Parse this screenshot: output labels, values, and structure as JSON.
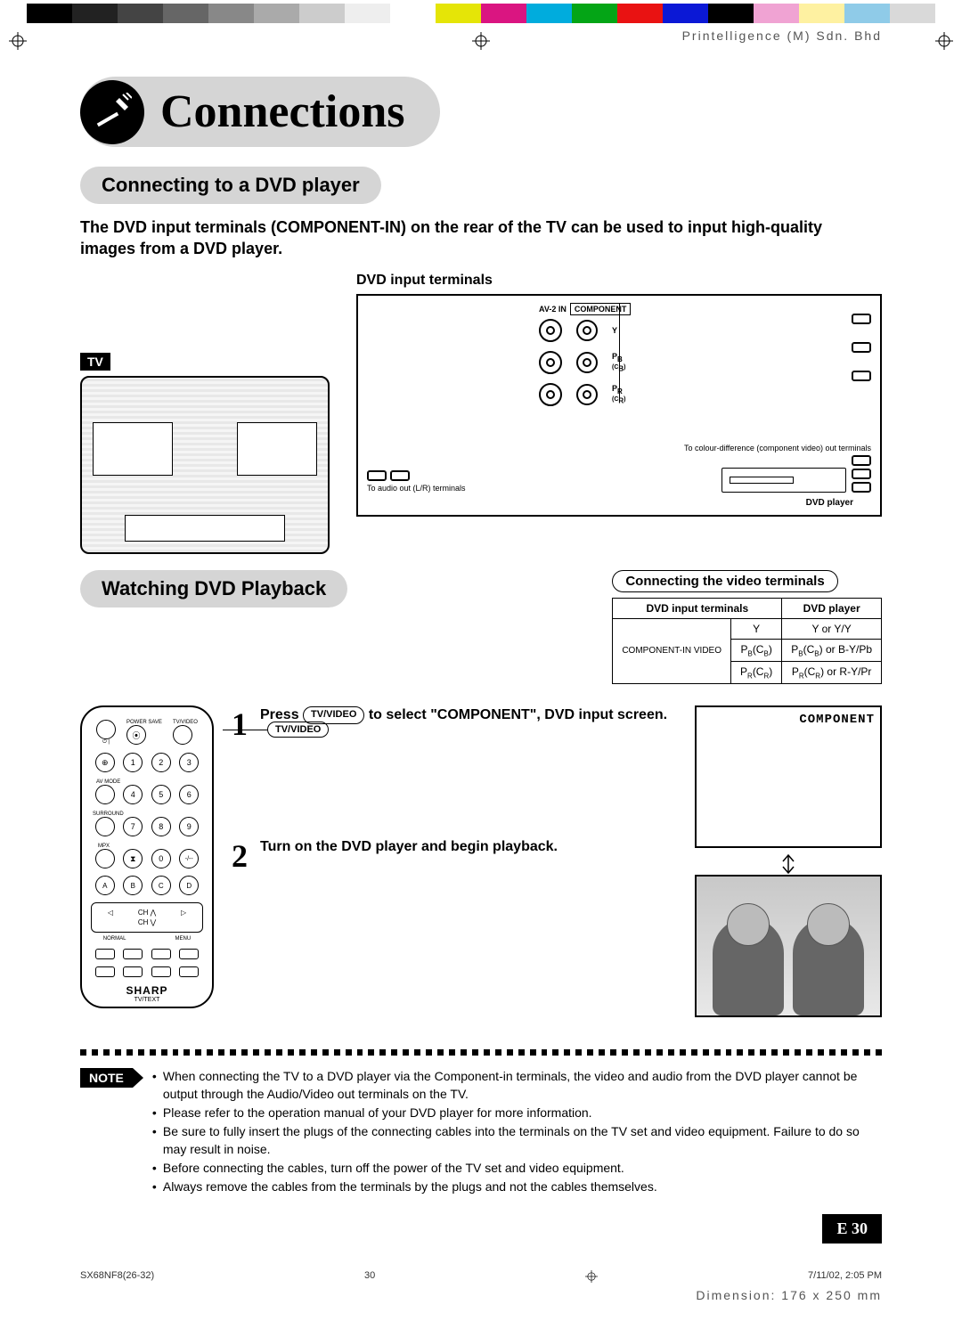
{
  "proof": {
    "printer": "Printelligence (M) Sdn. Bhd",
    "colors": [
      "#000000",
      "#222222",
      "#444444",
      "#666666",
      "#888888",
      "#aaaaaa",
      "#cccccc",
      "#eeeeee",
      "#ffffff",
      "#e5e507",
      "#da1581",
      "#00acdd",
      "#04a516",
      "#e91212",
      "#0b18d6",
      "#000000",
      "#f0a3d3",
      "#fef1a1",
      "#8fcbe8",
      "#d9d9d9"
    ],
    "file": "SX68NF8(26-32)",
    "sheet": "30",
    "timestamp": "7/11/02, 2:05 PM",
    "dimension": "Dimension: 176 x 250 mm"
  },
  "title": "Connections",
  "section1": {
    "heading": "Connecting to a DVD player",
    "lead": "The DVD input terminals (COMPONENT-IN) on the rear of the TV can be used to input high-quality images from a DVD player.",
    "tv_label": "TV",
    "dvd_inputs_label": "DVD input terminals",
    "panel_top_left": "AV-2 IN",
    "panel_top_right": "COMPONENT",
    "jack_y": "Y",
    "jack_pb": "PB (CB)",
    "jack_pr": "PR (CR)",
    "to_audio": "To audio out (L/R) terminals",
    "to_colour": "To colour-difference (component video) out terminals",
    "dvd_player_label": "DVD player",
    "table_caption": "Connecting the video terminals",
    "table": {
      "head1": "DVD input terminals",
      "head2": "DVD player",
      "row_group": "COMPONENT-IN VIDEO",
      "r1c1": "Y",
      "r1c2": "Y or Y/Y",
      "r2c1": "PB(CB)",
      "r2c2": "PB(CB) or B-Y/Pb",
      "r3c1": "PR(CR)",
      "r3c2": "PR(CR) or R-Y/Pr"
    }
  },
  "section2": {
    "heading": "Watching DVD Playback",
    "remote_callout": "TV/VIDEO",
    "remote_brand": "SHARP",
    "remote_brand_sub": "TV/TEXT",
    "remote": {
      "power": "POWER SAVE",
      "tvvideo": "TV/VIDEO",
      "avmode": "AV MODE",
      "nums": [
        "1",
        "2",
        "3",
        "4",
        "5",
        "6",
        "7",
        "8",
        "9",
        "0"
      ],
      "surround": "SURROUND",
      "mpx": "MPX",
      "normal": "NORMAL",
      "menu": "MENU",
      "ch_up": "CH ⋀",
      "ch_dn": "CH ⋁",
      "abcd": [
        "A",
        "B",
        "C",
        "D"
      ]
    },
    "step1_pre": "Press ",
    "step1_btn": "TV/VIDEO",
    "step1_post": " to select \"COMPONENT\", DVD input screen.",
    "osd": "COMPONENT",
    "step2": "Turn on the DVD player and begin playback."
  },
  "notes": {
    "label": "NOTE",
    "items": [
      "When connecting the TV to a DVD player via the Component-in terminals, the video and audio from the DVD player cannot be output through the Audio/Video out terminals on the TV.",
      "Please refer to the operation manual of your DVD player for more information.",
      "Be sure to fully insert the plugs of the connecting cables into the terminals on the TV set and video equipment. Failure to do so may result in noise.",
      "Before connecting the cables, turn off the power of the TV set and video equipment.",
      "Always remove the cables from the terminals by the plugs and not the cables themselves."
    ]
  },
  "page_number": "E 30"
}
